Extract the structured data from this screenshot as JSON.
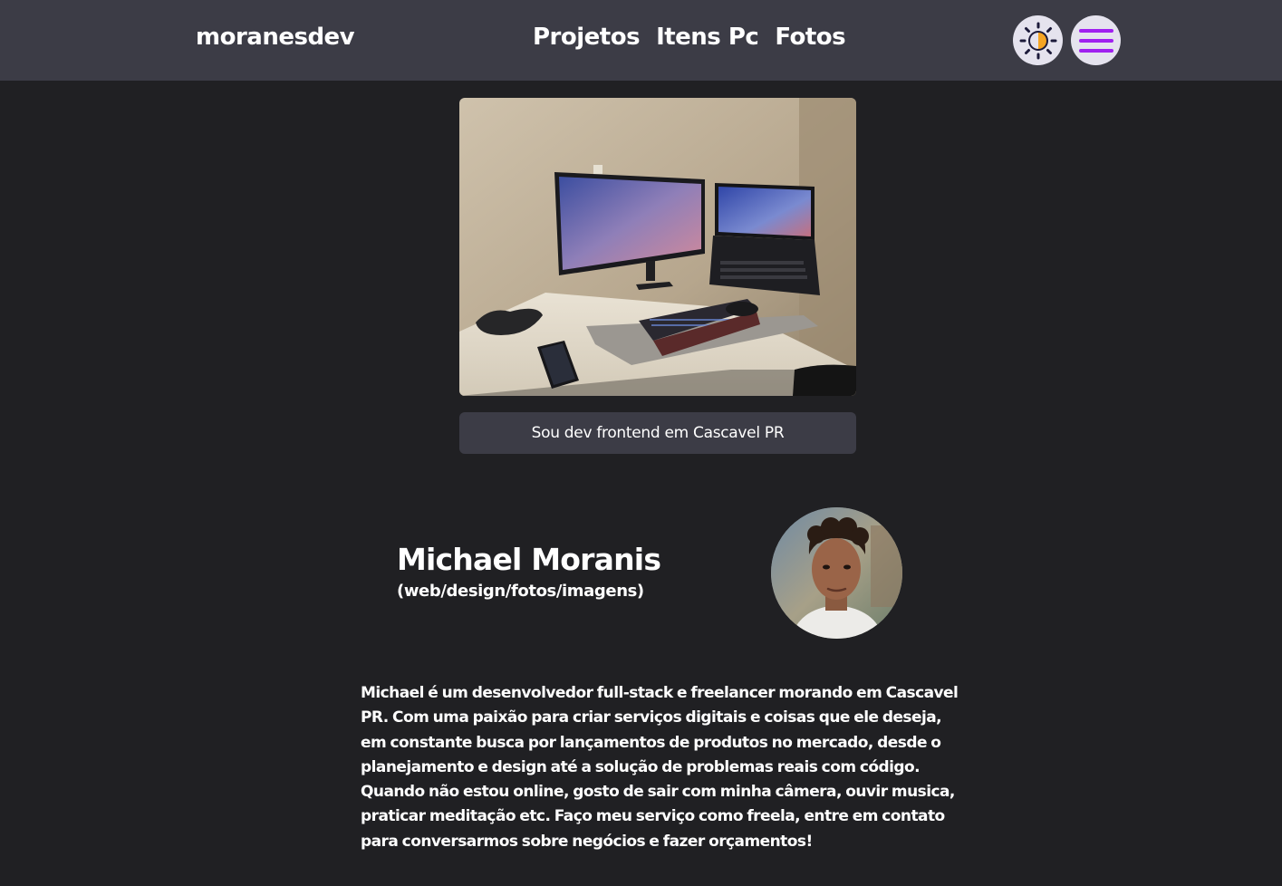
{
  "header": {
    "logo": "moranesdev",
    "nav": [
      {
        "label": "Projetos"
      },
      {
        "label": "Itens Pc"
      },
      {
        "label": "Fotos"
      }
    ]
  },
  "colors": {
    "background": "#202023",
    "navbar": "#3c3c46",
    "menu_accent": "#a020f0",
    "theme_icon_sun": "#f5a524",
    "theme_icon_moon": "#1c1a3a"
  },
  "icons": {
    "theme_toggle": "half-sun-theme-icon",
    "menu": "hamburger-menu-icon"
  },
  "hero": {
    "banner_text": "Sou dev frontend em Cascavel PR"
  },
  "profile": {
    "name": "Michael Moranis",
    "role": "(web/design/fotos/imagens)"
  },
  "bio": {
    "text": "Michael é um desenvolvedor full-stack e freelancer morando em Cascavel PR. Com uma paixão para criar serviços digitais e coisas que ele deseja, em constante busca por lançamentos de produtos no mercado, desde o planejamento e design até a solução de problemas reais com código. Quando não estou online, gosto de sair com minha câmera, ouvir musica, praticar meditação etc. Faço meu serviço como freela, entre em contato para conversarmos sobre negócios e fazer orçamentos!"
  }
}
